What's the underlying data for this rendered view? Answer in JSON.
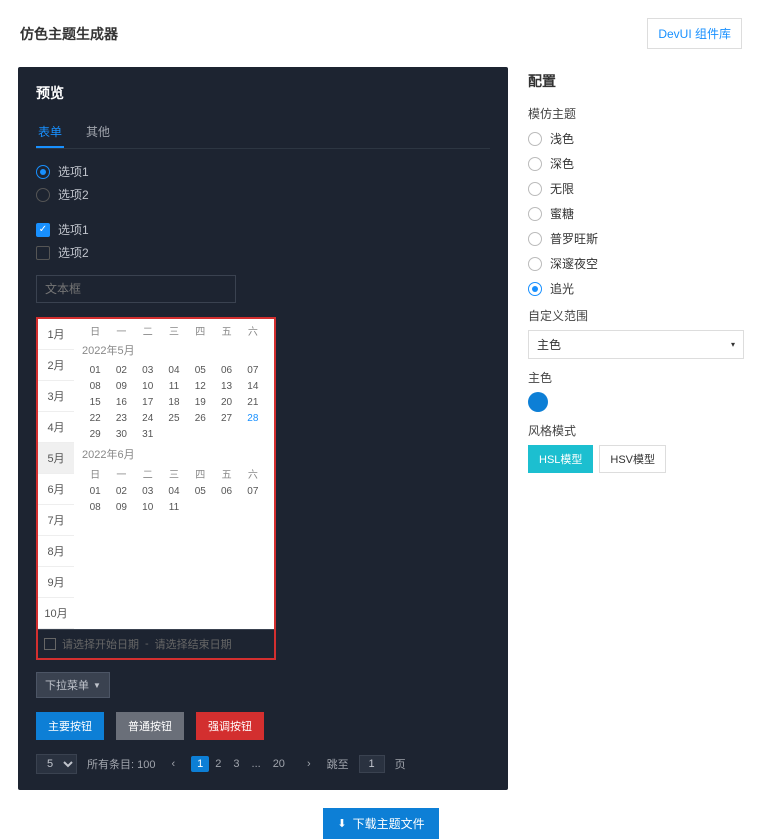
{
  "header": {
    "title": "仿色主题生成器",
    "devui_btn": "DevUI 组件库"
  },
  "preview": {
    "title": "预览",
    "tabs": {
      "form": "表单",
      "other": "其他"
    },
    "radio": {
      "opt1": "选项1",
      "opt2": "选项2"
    },
    "checkbox": {
      "opt1": "选项1",
      "opt2": "选项2"
    },
    "text_placeholder": "文本框",
    "datepicker": {
      "months": [
        "1月",
        "2月",
        "3月",
        "4月",
        "5月",
        "6月",
        "7月",
        "8月",
        "9月",
        "10月"
      ],
      "dow": [
        "日",
        "一",
        "二",
        "三",
        "四",
        "五",
        "六"
      ],
      "cap1": "2022年5月",
      "days1": [
        "01",
        "02",
        "03",
        "04",
        "05",
        "06",
        "07",
        "08",
        "09",
        "10",
        "11",
        "12",
        "13",
        "14",
        "15",
        "16",
        "17",
        "18",
        "19",
        "20",
        "21",
        "22",
        "23",
        "24",
        "25",
        "26",
        "27",
        "28",
        "29",
        "30",
        "31"
      ],
      "highlight1": "28",
      "cap2": "2022年6月",
      "days2": [
        "01",
        "02",
        "03",
        "04",
        "05",
        "06",
        "07",
        "08",
        "09",
        "10",
        "11"
      ],
      "range_start": "请选择开始日期",
      "range_sep": "-",
      "range_end": "请选择结束日期"
    },
    "dropdown": "下拉菜单",
    "buttons": {
      "primary": "主要按钮",
      "default": "普通按钮",
      "danger": "强调按钮"
    },
    "pager": {
      "size": "5",
      "total": "所有条目: 100",
      "pages": [
        "1",
        "2",
        "3",
        "...",
        "20"
      ],
      "jump_label": "跳至",
      "jump_value": "1",
      "page_unit": "页"
    }
  },
  "config": {
    "title": "配置",
    "theme_label": "模仿主题",
    "themes": [
      "浅色",
      "深色",
      "无限",
      "蜜糖",
      "普罗旺斯",
      "深邃夜空",
      "追光"
    ],
    "selected_theme": "追光",
    "custom_range_label": "自定义范围",
    "custom_range_value": "主色",
    "color_label": "主色",
    "color_value": "#0d7fd6",
    "mode_label": "风格模式",
    "modes": {
      "hsl": "HSL模型",
      "hsv": "HSV模型"
    }
  },
  "download": "下载主题文件"
}
